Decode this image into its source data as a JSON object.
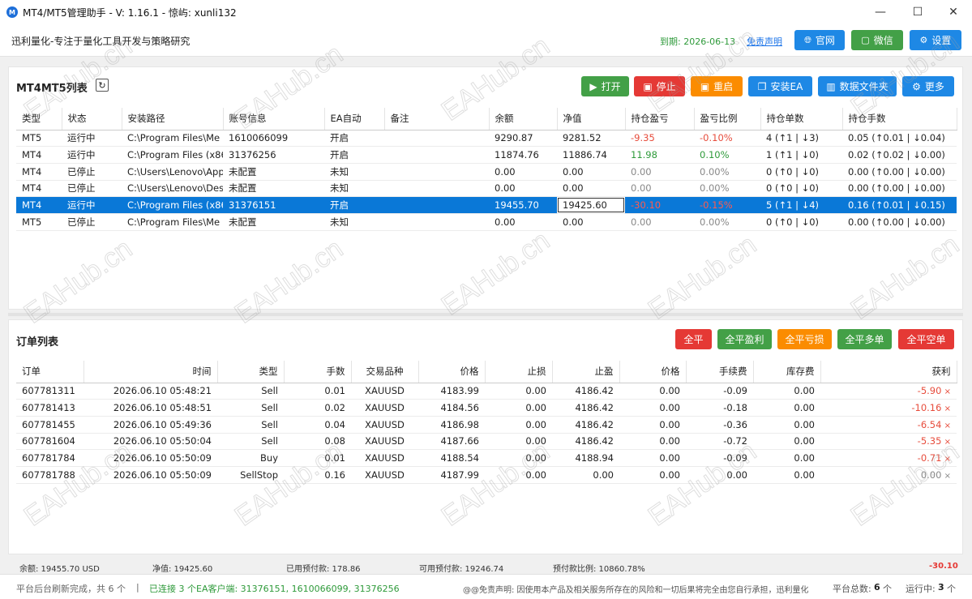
{
  "window": {
    "title": "MT4/MT5管理助手 - V: 1.16.1 - 惊屿: xunli132",
    "icon_letter": "M"
  },
  "header": {
    "slogan": "迅利量化-专注于量化工具开发与策略研究",
    "expire": "到期: 2026-06-13",
    "disclaimer": "免责声明",
    "buttons": {
      "website": "官网",
      "wechat": "微信",
      "settings": "设置"
    }
  },
  "accounts": {
    "title": "MT4MT5列表",
    "toolbar": {
      "open": "打开",
      "stop": "停止",
      "restart": "重启",
      "install_ea": "安装EA",
      "data_folder": "数据文件夹",
      "more": "更多"
    },
    "columns": [
      "类型",
      "状态",
      "安装路径",
      "账号信息",
      "EA自动",
      "备注",
      "余额",
      "净值",
      "持仓盈亏",
      "盈亏比例",
      "持仓单数",
      "持仓手数"
    ],
    "rows": [
      [
        "MT5",
        "运行中",
        "C:\\Program Files\\Me",
        "1610066099",
        "开启",
        "",
        "9290.87",
        "9281.52",
        "-9.35",
        "-0.10%",
        "4 (↑1 | ↓3)",
        "0.05 (↑0.01 | ↓0.04)"
      ],
      [
        "MT4",
        "运行中",
        "C:\\Program Files (x86",
        "31376256",
        "开启",
        "",
        "11874.76",
        "11886.74",
        "11.98",
        "0.10%",
        "1 (↑1 | ↓0)",
        "0.02 (↑0.02 | ↓0.00)"
      ],
      [
        "MT4",
        "已停止",
        "C:\\Users\\Lenovo\\App",
        "未配置",
        "未知",
        "",
        "0.00",
        "0.00",
        "0.00",
        "0.00%",
        "0 (↑0 | ↓0)",
        "0.00 (↑0.00 | ↓0.00)"
      ],
      [
        "MT4",
        "已停止",
        "C:\\Users\\Lenovo\\Des",
        "未配置",
        "未知",
        "",
        "0.00",
        "0.00",
        "0.00",
        "0.00%",
        "0 (↑0 | ↓0)",
        "0.00 (↑0.00 | ↓0.00)"
      ],
      [
        "MT4",
        "运行中",
        "C:\\Program Files (x86",
        "31376151",
        "开启",
        "",
        "19455.70",
        "19425.60",
        "-30.10",
        "-0.15%",
        "5 (↑1 | ↓4)",
        "0.16 (↑0.01 | ↓0.15)"
      ],
      [
        "MT5",
        "已停止",
        "C:\\Program Files\\Me",
        "未配置",
        "未知",
        "",
        "0.00",
        "0.00",
        "0.00",
        "0.00%",
        "0 (↑0 | ↓0)",
        "0.00 (↑0.00 | ↓0.00)"
      ]
    ],
    "selected_row": 4
  },
  "orders": {
    "title": "订单列表",
    "toolbar": {
      "close_all": "全平",
      "close_profit": "全平盈利",
      "close_loss": "全平亏损",
      "close_long": "全平多单",
      "close_short": "全平空单"
    },
    "columns": [
      "订单",
      "时间",
      "类型",
      "手数",
      "交易品种",
      "价格",
      "止损",
      "止盈",
      "价格",
      "手续费",
      "库存费",
      "获利"
    ],
    "rows": [
      [
        "607781311",
        "2026.06.10 05:48:21",
        "Sell",
        "0.01",
        "XAUUSD",
        "4183.99",
        "0.00",
        "4186.42",
        "0.00",
        "-0.09",
        "0.00",
        "-5.90"
      ],
      [
        "607781413",
        "2026.06.10 05:48:51",
        "Sell",
        "0.02",
        "XAUUSD",
        "4184.56",
        "0.00",
        "4186.42",
        "0.00",
        "-0.18",
        "0.00",
        "-10.16"
      ],
      [
        "607781455",
        "2026.06.10 05:49:36",
        "Sell",
        "0.04",
        "XAUUSD",
        "4186.98",
        "0.00",
        "4186.42",
        "0.00",
        "-0.36",
        "0.00",
        "-6.54"
      ],
      [
        "607781604",
        "2026.06.10 05:50:04",
        "Sell",
        "0.08",
        "XAUUSD",
        "4187.66",
        "0.00",
        "4186.42",
        "0.00",
        "-0.72",
        "0.00",
        "-5.35"
      ],
      [
        "607781784",
        "2026.06.10 05:50:09",
        "Buy",
        "0.01",
        "XAUUSD",
        "4188.54",
        "0.00",
        "4188.94",
        "0.00",
        "-0.09",
        "0.00",
        "-0.71"
      ],
      [
        "607781788",
        "2026.06.10 05:50:09",
        "SellStop",
        "0.16",
        "XAUUSD",
        "4187.99",
        "0.00",
        "0.00",
        "0.00",
        "0.00",
        "0.00",
        "0.00"
      ]
    ],
    "close_mark": "×"
  },
  "summary": {
    "balance": "余额: 19455.70 USD",
    "equity": "净值: 19425.60",
    "used_margin": "已用预付款: 178.86",
    "free_margin": "可用预付款: 19246.74",
    "margin_level": "预付款比例: 10860.78%",
    "profit": "-30.10"
  },
  "status": {
    "refresh": "平台后台刷新完成，共 6 个",
    "separator": "|",
    "connected": "已连接 3 个EA客户端: 31376151, 1610066099, 31376256",
    "notice": "@@免责声明: 因使用本产品及相关服务所存在的风险和一切后果将完全由您自行承担，迅利量化",
    "total_label": "平台总数:",
    "total_value": "6",
    "total_unit": "个",
    "running_label": "运行中:",
    "running_value": "3",
    "running_unit": "个"
  },
  "watermark": "EAHub.cn",
  "colors": {
    "blue": "#1e88e5",
    "green": "#43a047",
    "red": "#e53935",
    "orange": "#fb8c00",
    "select": "#0a78d7"
  }
}
